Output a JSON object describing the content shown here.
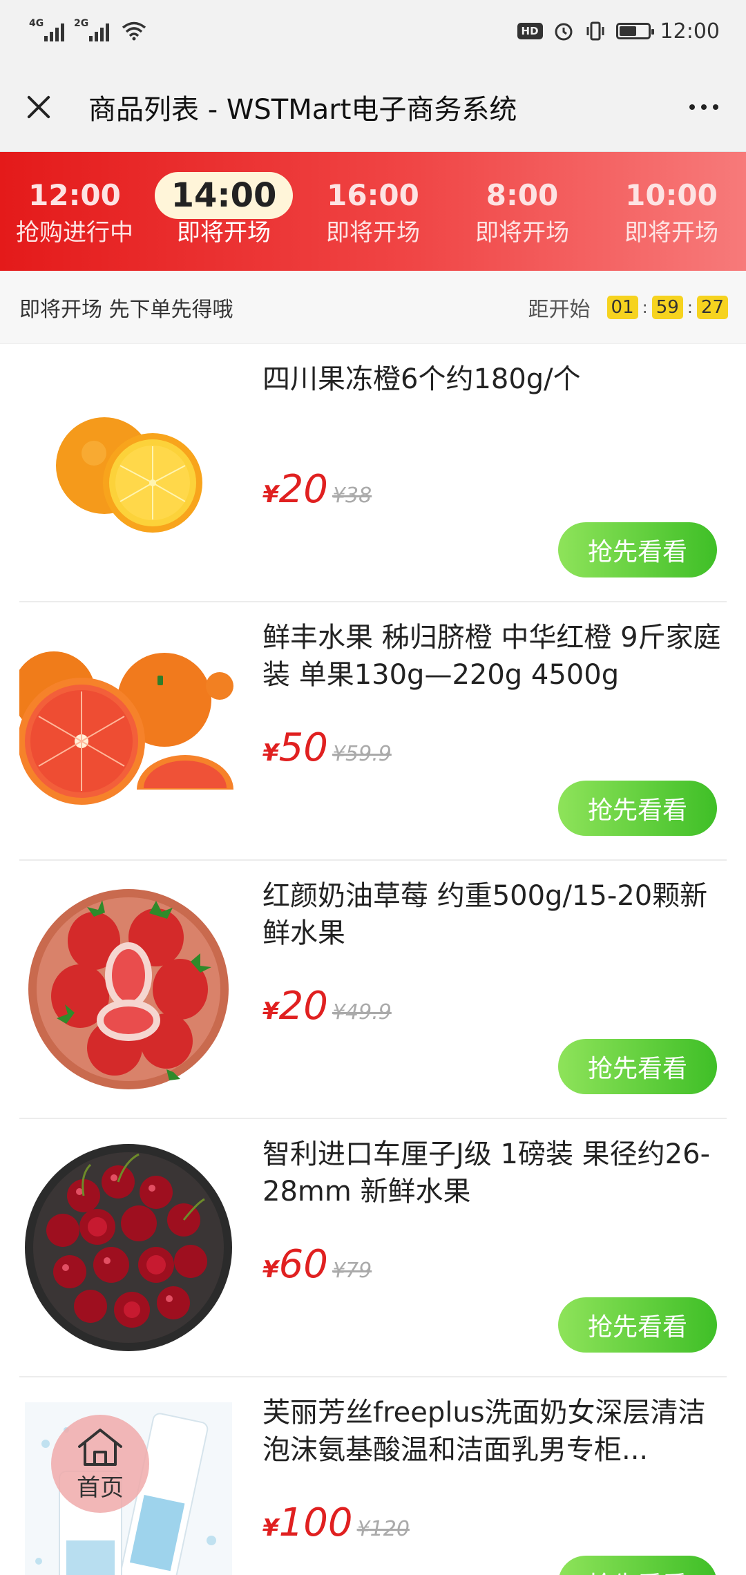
{
  "status_bar": {
    "network_1": "4G",
    "network_2": "2G",
    "hd": "HD",
    "time": "12:00",
    "battery_level": 0.55
  },
  "title_bar": {
    "title": "商品列表 - WSTMart电子商务系统",
    "close_icon": "close-icon",
    "more_icon": "more-icon"
  },
  "time_tabs": [
    {
      "time": "12:00",
      "status": "抢购进行中"
    },
    {
      "time": "14:00",
      "status": "即将开场"
    },
    {
      "time": "16:00",
      "status": "即将开场"
    },
    {
      "time": "8:00",
      "status": "即将开场"
    },
    {
      "time": "10:00",
      "status": "即将开场"
    }
  ],
  "countdown": {
    "hint": "即将开场 先下单先得哦",
    "label": "距开始",
    "hours": "01",
    "minutes": "59",
    "seconds": "27"
  },
  "products": [
    {
      "name": "四川果冻橙6个约180g/个",
      "currency": "¥",
      "price": "20",
      "original": "¥38",
      "button": "抢先看看",
      "image": "orange-icon"
    },
    {
      "name": "鲜丰水果 秭归脐橙 中华红橙 9斤家庭装 单果130g—220g 4500g",
      "currency": "¥",
      "price": "50",
      "original": "¥59.9",
      "button": "抢先看看",
      "image": "red-orange-icon"
    },
    {
      "name": "红颜奶油草莓 约重500g/15-20颗新鲜水果",
      "currency": "¥",
      "price": "20",
      "original": "¥49.9",
      "button": "抢先看看",
      "image": "strawberry-icon"
    },
    {
      "name": "智利进口车厘子J级 1磅装 果径约26-28mm 新鲜水果",
      "currency": "¥",
      "price": "60",
      "original": "¥79",
      "button": "抢先看看",
      "image": "cherry-icon"
    },
    {
      "name": "芙丽芳丝freeplus洗面奶女深层清洁泡沫氨基酸温和洁面乳男专柜...",
      "currency": "¥",
      "price": "100",
      "original": "¥120",
      "button": "抢先看看",
      "image": "cleanser-icon"
    }
  ],
  "home_float": {
    "label": "首页",
    "icon": "home-icon"
  },
  "colors": {
    "accent_red": "#e41a1a",
    "price_red": "#e02020",
    "button_green": "#3fbf27",
    "countdown_yellow": "#f6d31f"
  }
}
